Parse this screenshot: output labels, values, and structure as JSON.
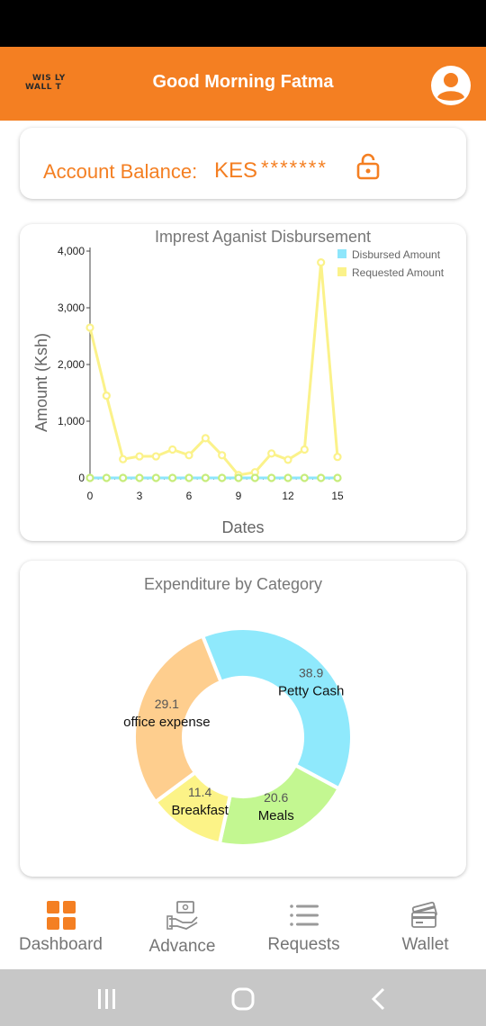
{
  "header": {
    "logo_line1": "WIS  LY",
    "logo_line2": "WALL  T",
    "greeting": "Good Morning Fatma",
    "profile_icon": "account-circle-icon",
    "color": "#f47f22"
  },
  "balance": {
    "label": "Account Balance:",
    "currency": "KES",
    "masked_value": "*******",
    "lock_icon": "lock-open-icon"
  },
  "chart_data": [
    {
      "type": "line",
      "title": "Imprest Aganist Disbursement",
      "xlabel": "Dates",
      "ylabel": "Amount (Ksh)",
      "x_ticks": [
        "0",
        "3",
        "6",
        "9",
        "12",
        "15"
      ],
      "y_ticks": [
        "0",
        "1,000",
        "2,000",
        "3,000",
        "4,000"
      ],
      "xlim": [
        0,
        15
      ],
      "ylim": [
        0,
        4000
      ],
      "legend": "top-right",
      "x": [
        0,
        1,
        2,
        3,
        4,
        5,
        6,
        7,
        8,
        9,
        10,
        11,
        12,
        13,
        14,
        15
      ],
      "series": [
        {
          "name": "Disbursed Amount",
          "color": "#8ee6fb",
          "values": [
            0,
            0,
            0,
            0,
            0,
            0,
            0,
            0,
            0,
            0,
            0,
            0,
            0,
            0,
            0,
            0
          ]
        },
        {
          "name": "Requested Amount",
          "color": "#fbf28a",
          "values": [
            2650,
            1450,
            330,
            380,
            380,
            500,
            400,
            700,
            400,
            50,
            100,
            430,
            320,
            500,
            3800,
            370
          ]
        }
      ]
    },
    {
      "type": "pie",
      "title": "Expenditure by Category",
      "donut": true,
      "categories": [
        "Petty Cash",
        "Meals",
        "Breakfast",
        "office expense"
      ],
      "values": [
        38.9,
        20.6,
        11.4,
        29.1
      ],
      "labels": [
        "38.9",
        "20.6",
        "11.4",
        "29.1"
      ],
      "colors": [
        "#8fe9fc",
        "#c3f791",
        "#fcf387",
        "#fece8e"
      ]
    }
  ],
  "nav": {
    "items": [
      {
        "label": "Dashboard",
        "icon": "dashboard-icon",
        "active": true
      },
      {
        "label": "Advance",
        "icon": "cash-hand-icon",
        "active": false
      },
      {
        "label": "Requests",
        "icon": "list-icon",
        "active": false
      },
      {
        "label": "Wallet",
        "icon": "wallet-cards-icon",
        "active": false
      }
    ]
  },
  "system_nav": {
    "recent": "recent-apps-icon",
    "home": "home-icon",
    "back": "back-icon"
  }
}
